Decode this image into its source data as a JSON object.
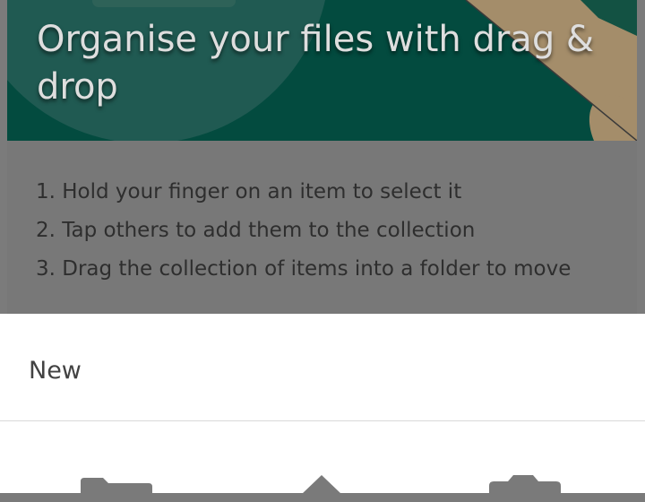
{
  "banner": {
    "title": "Organise your files with drag & drop"
  },
  "instructions": {
    "steps": [
      "1. Hold your finger on an item to select it",
      "2. Tap others to add them to the collection",
      "3. Drag the collection of items into a folder to move"
    ]
  },
  "new_sheet": {
    "title": "New",
    "actions": [
      {
        "icon": "folder-icon"
      },
      {
        "icon": "upload-icon"
      },
      {
        "icon": "camera-icon"
      }
    ]
  },
  "colors": {
    "banner_green": "#034b3f",
    "banner_tan": "#a48d6a",
    "scrim_gray": "#7b7b7b",
    "sheet_white": "#ffffff",
    "icon_gray": "#7a7a7a"
  }
}
